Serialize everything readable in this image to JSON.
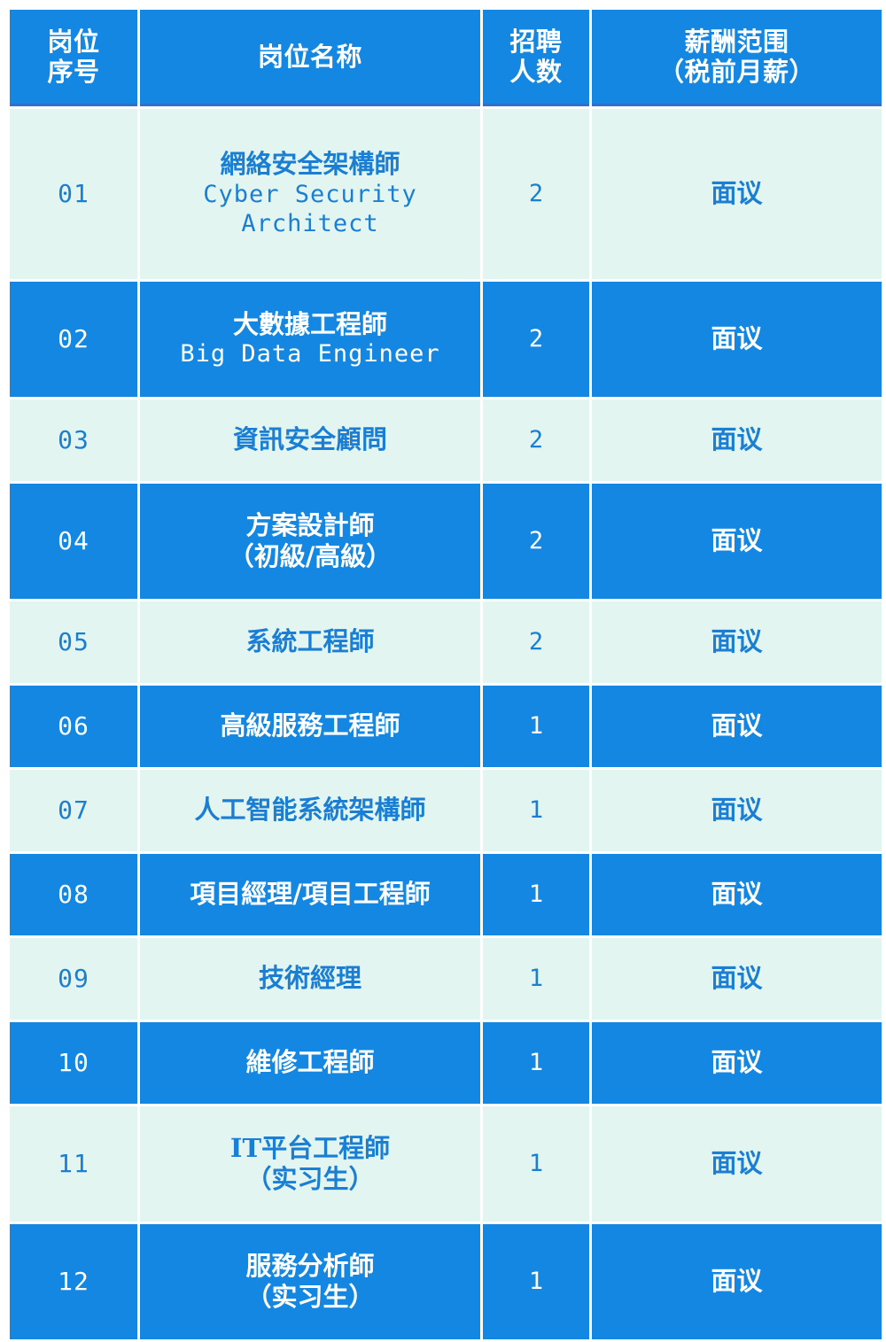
{
  "table": {
    "columns": [
      {
        "key": "no",
        "lines": [
          "岗位",
          "序号"
        ]
      },
      {
        "key": "name",
        "lines": [
          "岗位名称"
        ]
      },
      {
        "key": "count",
        "lines": [
          "招聘",
          "人数"
        ]
      },
      {
        "key": "salary",
        "lines": [
          "薪酬范围",
          "（税前月薪）"
        ]
      }
    ],
    "colors": {
      "header_bg": "#1387e2",
      "header_text": "#ffffff",
      "row_blue_bg": "#1387e2",
      "row_blue_text": "#ffffff",
      "row_light_bg": "#e3f5f0",
      "row_light_text": "#1a7fd4",
      "header_rule": "#2f6fd0",
      "page_bg": "#ffffff"
    },
    "rows": [
      {
        "no": "01",
        "name_lines": [
          "網絡安全架構師",
          "Cyber Security",
          "Architect"
        ],
        "name_en_from": 1,
        "count": "2",
        "salary": "面议",
        "style": "light"
      },
      {
        "no": "02",
        "name_lines": [
          "大數據工程師",
          "Big Data Engineer"
        ],
        "name_en_from": 1,
        "count": "2",
        "salary": "面议",
        "style": "blue"
      },
      {
        "no": "03",
        "name_lines": [
          "資訊安全顧問"
        ],
        "name_en_from": 99,
        "count": "2",
        "salary": "面议",
        "style": "light"
      },
      {
        "no": "04",
        "name_lines": [
          "方案設計師",
          "（初級/高級）"
        ],
        "name_en_from": 99,
        "count": "2",
        "salary": "面议",
        "style": "blue"
      },
      {
        "no": "05",
        "name_lines": [
          "系統工程師"
        ],
        "name_en_from": 99,
        "count": "2",
        "salary": "面议",
        "style": "light"
      },
      {
        "no": "06",
        "name_lines": [
          "高級服務工程師"
        ],
        "name_en_from": 99,
        "count": "1",
        "salary": "面议",
        "style": "blue"
      },
      {
        "no": "07",
        "name_lines": [
          "人工智能系統架構師"
        ],
        "name_en_from": 99,
        "count": "1",
        "salary": "面议",
        "style": "light"
      },
      {
        "no": "08",
        "name_lines": [
          "項目經理/項目工程師"
        ],
        "name_en_from": 99,
        "count": "1",
        "salary": "面议",
        "style": "blue"
      },
      {
        "no": "09",
        "name_lines": [
          "技術經理"
        ],
        "name_en_from": 99,
        "count": "1",
        "salary": "面议",
        "style": "light"
      },
      {
        "no": "10",
        "name_lines": [
          "維修工程師"
        ],
        "name_en_from": 99,
        "count": "1",
        "salary": "面议",
        "style": "blue"
      },
      {
        "no": "11",
        "name_lines": [
          "IT平台工程師",
          "（实习生）"
        ],
        "name_en_from": 99,
        "count": "1",
        "salary": "面议",
        "style": "light"
      },
      {
        "no": "12",
        "name_lines": [
          "服務分析師",
          "（实习生）"
        ],
        "name_en_from": 99,
        "count": "1",
        "salary": "面议",
        "style": "blue"
      }
    ]
  }
}
